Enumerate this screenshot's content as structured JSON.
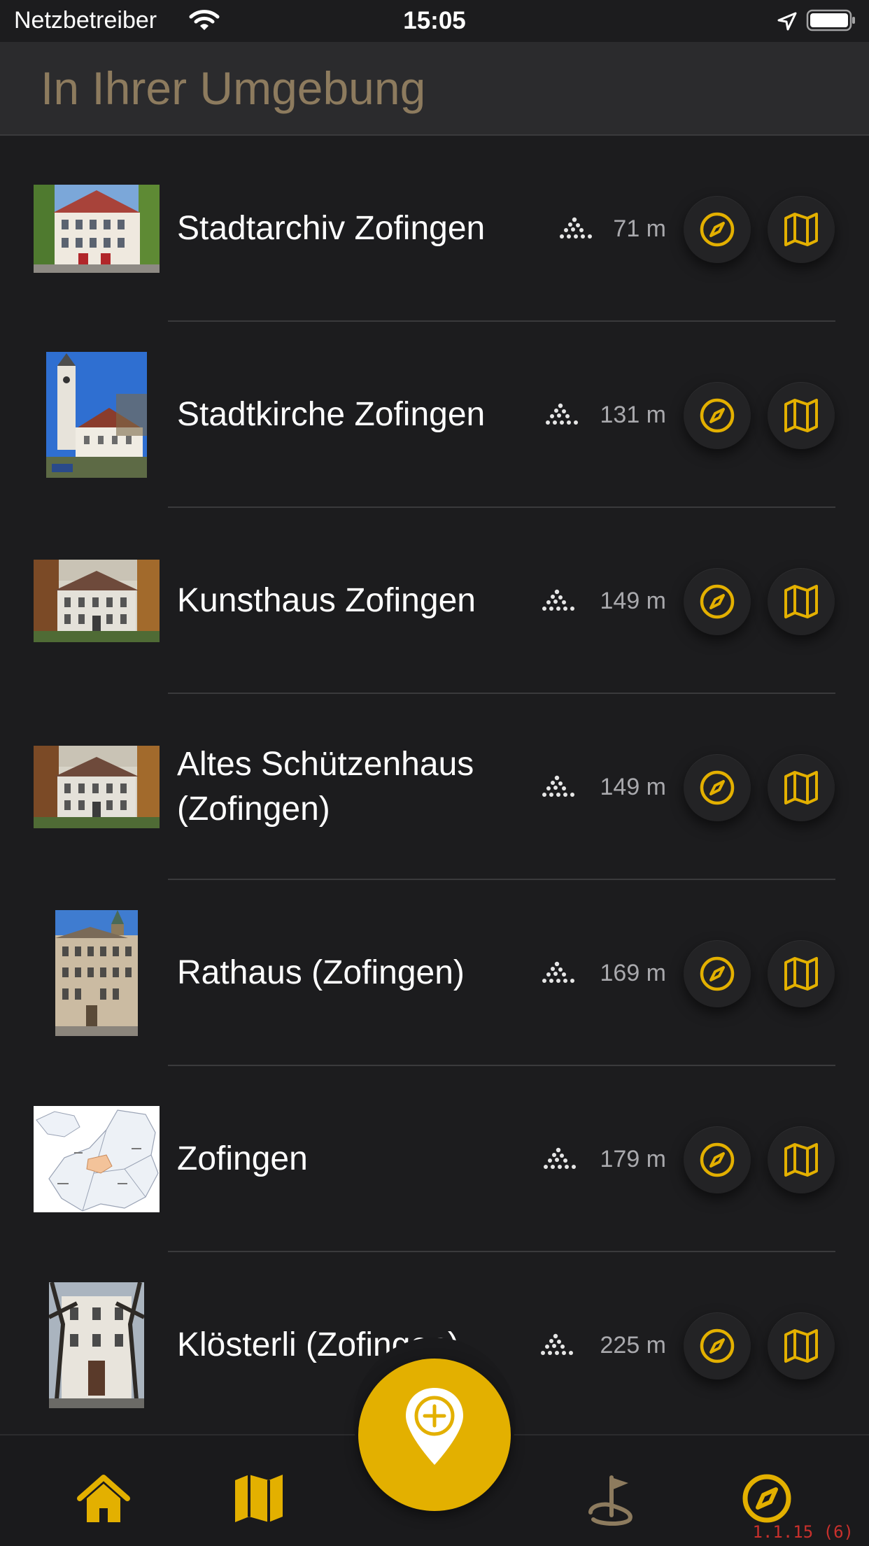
{
  "status_bar": {
    "carrier": "Netzbetreiber",
    "time": "15:05"
  },
  "header": {
    "title": "In Ihrer Umgebung"
  },
  "colors": {
    "accent": "#e3b000",
    "background": "#1c1c1e",
    "header_title": "#8d7b5e",
    "distance_text": "#a9a9ad"
  },
  "places": [
    {
      "title": "Stadtarchiv Zofingen",
      "distance": "71 m",
      "image_kind": "house-landscape"
    },
    {
      "title": "Stadtkirche Zofingen",
      "distance": "131 m",
      "image_kind": "church-portrait"
    },
    {
      "title": "Kunsthaus Zofingen",
      "distance": "149 m",
      "image_kind": "villa-landscape"
    },
    {
      "title": "Altes Schützenhaus (Zofingen)",
      "distance": "149 m",
      "image_kind": "villa-landscape"
    },
    {
      "title": "Rathaus (Zofingen)",
      "distance": "169 m",
      "image_kind": "townhall-portrait"
    },
    {
      "title": "Zofingen",
      "distance": "179 m",
      "image_kind": "map-landscape"
    },
    {
      "title": "Klösterli (Zofingen)",
      "distance": "225 m",
      "image_kind": "facade-portrait"
    }
  ],
  "icons": {
    "row_walk": "walking-dots-icon",
    "row_compass": "compass-icon",
    "row_map": "map-icon",
    "tab_home": "home-icon",
    "tab_map": "map-icon",
    "fab": "add-location-icon",
    "tab_tour": "tour-flag-icon",
    "tab_compass": "compass-icon"
  },
  "footer": {
    "version": "1.1.15 (6)"
  }
}
